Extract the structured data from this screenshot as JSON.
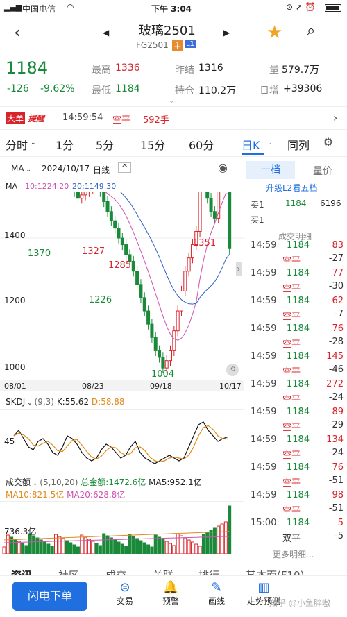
{
  "status": {
    "carrier": "中国电信",
    "time": "下午 3:04"
  },
  "header": {
    "title": "玻璃2501",
    "code": "FG2501",
    "badge_main": "主",
    "badge_l1": "L1"
  },
  "quote": {
    "price": "1184",
    "change": "-126",
    "change_pct": "-9.62%",
    "high_label": "最高",
    "high": "1336",
    "low_label": "最低",
    "low": "1184",
    "preclose_label": "昨结",
    "preclose": "1316",
    "oi_label": "持仓",
    "oi": "110.2万",
    "vol_label": "量",
    "vol": "579.7万",
    "daychg_label": "日增",
    "daychg": "+39306"
  },
  "alert": {
    "tag1": "大单",
    "tag2": "提醒",
    "time": "14:59:54",
    "type": "空平",
    "size": "592手"
  },
  "tabs": [
    "分时",
    "1分",
    "5分",
    "15分",
    "60分",
    "日K",
    "同列"
  ],
  "active_tab": "日K",
  "chart_header": {
    "ma": "MA",
    "date": "2024/10/17",
    "period": "日线"
  },
  "ma_legend": {
    "ma": "MA",
    "ma10": "10:1224.20",
    "ma20": "20:1149.30"
  },
  "kline": {
    "y_labels": [
      "1400",
      "1200",
      "1000"
    ],
    "x_labels": [
      "08/01",
      "08/23",
      "09/18",
      "10/17"
    ],
    "annotations": [
      "1370",
      "1327",
      "1285",
      "1226",
      "1004",
      "1351"
    ]
  },
  "skdj": {
    "name": "SKDJ",
    "params": "(9,3)",
    "k": "K:55.62",
    "d": "D:58.88",
    "level": "45"
  },
  "volume": {
    "name": "成交额",
    "params": "(5,10,20)",
    "total": "总金额:1472.6亿",
    "ma5": "MA5:952.1亿",
    "ma10": "MA10:821.5亿",
    "ma20": "MA20:628.8亿",
    "axis": "736.3亿"
  },
  "orderbook": {
    "tab1": "一档",
    "tab2": "量价",
    "upgrade": "升级L2看五档",
    "sell1_label": "卖1",
    "sell1_price": "1184",
    "sell1_vol": "6196",
    "buy1_label": "买1",
    "buy1_price": "--",
    "buy1_vol": "--",
    "detail_title": "成交明细",
    "trades": [
      {
        "time": "14:59",
        "price": "1184",
        "vol": "83",
        "type": "空平",
        "chg": "-27"
      },
      {
        "time": "14:59",
        "price": "1184",
        "vol": "77",
        "type": "空平",
        "chg": "-30"
      },
      {
        "time": "14:59",
        "price": "1184",
        "vol": "62",
        "type": "空平",
        "chg": "-7"
      },
      {
        "time": "14:59",
        "price": "1184",
        "vol": "76",
        "type": "空平",
        "chg": "-28"
      },
      {
        "time": "14:59",
        "price": "1184",
        "vol": "145",
        "type": "空平",
        "chg": "-46"
      },
      {
        "time": "14:59",
        "price": "1184",
        "vol": "272",
        "type": "空平",
        "chg": "-24"
      },
      {
        "time": "14:59",
        "price": "1184",
        "vol": "89",
        "type": "空平",
        "chg": "-29"
      },
      {
        "time": "14:59",
        "price": "1184",
        "vol": "134",
        "type": "空平",
        "chg": "-24"
      },
      {
        "time": "14:59",
        "price": "1184",
        "vol": "76",
        "type": "空平",
        "chg": "-51"
      },
      {
        "time": "14:59",
        "price": "1184",
        "vol": "98",
        "type": "空平",
        "chg": "-51"
      },
      {
        "time": "15:00",
        "price": "1184",
        "vol": "5",
        "type": "双平",
        "chg": "-5"
      }
    ],
    "more": "更多明细..."
  },
  "bottom_tabs": [
    "资讯",
    "社区",
    "成交",
    "关联",
    "排行",
    "基本面(F10)"
  ],
  "bottom": {
    "primary": "闪电下单",
    "items": [
      "交易",
      "预警",
      "画线",
      "走势预测"
    ],
    "watermark": "知乎 @小鱼胖嗷"
  },
  "colors": {
    "up": "#d8232a",
    "down": "#1a8a3a",
    "accent": "#1f6fe0"
  }
}
